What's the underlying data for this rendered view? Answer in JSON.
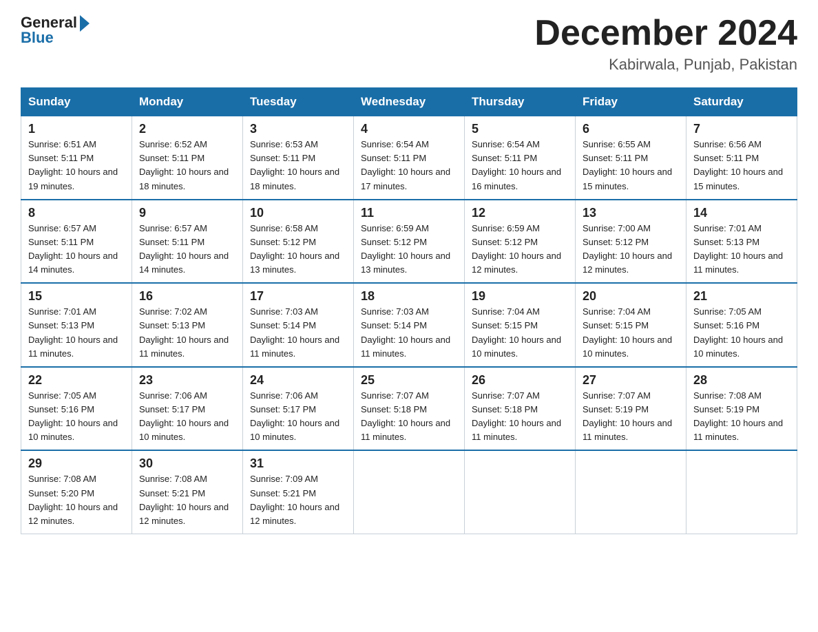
{
  "logo": {
    "general": "General",
    "blue": "Blue"
  },
  "title": {
    "month": "December 2024",
    "location": "Kabirwala, Punjab, Pakistan"
  },
  "weekdays": [
    "Sunday",
    "Monday",
    "Tuesday",
    "Wednesday",
    "Thursday",
    "Friday",
    "Saturday"
  ],
  "weeks": [
    [
      {
        "day": "1",
        "sunrise": "6:51 AM",
        "sunset": "5:11 PM",
        "daylight": "10 hours and 19 minutes."
      },
      {
        "day": "2",
        "sunrise": "6:52 AM",
        "sunset": "5:11 PM",
        "daylight": "10 hours and 18 minutes."
      },
      {
        "day": "3",
        "sunrise": "6:53 AM",
        "sunset": "5:11 PM",
        "daylight": "10 hours and 18 minutes."
      },
      {
        "day": "4",
        "sunrise": "6:54 AM",
        "sunset": "5:11 PM",
        "daylight": "10 hours and 17 minutes."
      },
      {
        "day": "5",
        "sunrise": "6:54 AM",
        "sunset": "5:11 PM",
        "daylight": "10 hours and 16 minutes."
      },
      {
        "day": "6",
        "sunrise": "6:55 AM",
        "sunset": "5:11 PM",
        "daylight": "10 hours and 15 minutes."
      },
      {
        "day": "7",
        "sunrise": "6:56 AM",
        "sunset": "5:11 PM",
        "daylight": "10 hours and 15 minutes."
      }
    ],
    [
      {
        "day": "8",
        "sunrise": "6:57 AM",
        "sunset": "5:11 PM",
        "daylight": "10 hours and 14 minutes."
      },
      {
        "day": "9",
        "sunrise": "6:57 AM",
        "sunset": "5:11 PM",
        "daylight": "10 hours and 14 minutes."
      },
      {
        "day": "10",
        "sunrise": "6:58 AM",
        "sunset": "5:12 PM",
        "daylight": "10 hours and 13 minutes."
      },
      {
        "day": "11",
        "sunrise": "6:59 AM",
        "sunset": "5:12 PM",
        "daylight": "10 hours and 13 minutes."
      },
      {
        "day": "12",
        "sunrise": "6:59 AM",
        "sunset": "5:12 PM",
        "daylight": "10 hours and 12 minutes."
      },
      {
        "day": "13",
        "sunrise": "7:00 AM",
        "sunset": "5:12 PM",
        "daylight": "10 hours and 12 minutes."
      },
      {
        "day": "14",
        "sunrise": "7:01 AM",
        "sunset": "5:13 PM",
        "daylight": "10 hours and 11 minutes."
      }
    ],
    [
      {
        "day": "15",
        "sunrise": "7:01 AM",
        "sunset": "5:13 PM",
        "daylight": "10 hours and 11 minutes."
      },
      {
        "day": "16",
        "sunrise": "7:02 AM",
        "sunset": "5:13 PM",
        "daylight": "10 hours and 11 minutes."
      },
      {
        "day": "17",
        "sunrise": "7:03 AM",
        "sunset": "5:14 PM",
        "daylight": "10 hours and 11 minutes."
      },
      {
        "day": "18",
        "sunrise": "7:03 AM",
        "sunset": "5:14 PM",
        "daylight": "10 hours and 11 minutes."
      },
      {
        "day": "19",
        "sunrise": "7:04 AM",
        "sunset": "5:15 PM",
        "daylight": "10 hours and 10 minutes."
      },
      {
        "day": "20",
        "sunrise": "7:04 AM",
        "sunset": "5:15 PM",
        "daylight": "10 hours and 10 minutes."
      },
      {
        "day": "21",
        "sunrise": "7:05 AM",
        "sunset": "5:16 PM",
        "daylight": "10 hours and 10 minutes."
      }
    ],
    [
      {
        "day": "22",
        "sunrise": "7:05 AM",
        "sunset": "5:16 PM",
        "daylight": "10 hours and 10 minutes."
      },
      {
        "day": "23",
        "sunrise": "7:06 AM",
        "sunset": "5:17 PM",
        "daylight": "10 hours and 10 minutes."
      },
      {
        "day": "24",
        "sunrise": "7:06 AM",
        "sunset": "5:17 PM",
        "daylight": "10 hours and 10 minutes."
      },
      {
        "day": "25",
        "sunrise": "7:07 AM",
        "sunset": "5:18 PM",
        "daylight": "10 hours and 11 minutes."
      },
      {
        "day": "26",
        "sunrise": "7:07 AM",
        "sunset": "5:18 PM",
        "daylight": "10 hours and 11 minutes."
      },
      {
        "day": "27",
        "sunrise": "7:07 AM",
        "sunset": "5:19 PM",
        "daylight": "10 hours and 11 minutes."
      },
      {
        "day": "28",
        "sunrise": "7:08 AM",
        "sunset": "5:19 PM",
        "daylight": "10 hours and 11 minutes."
      }
    ],
    [
      {
        "day": "29",
        "sunrise": "7:08 AM",
        "sunset": "5:20 PM",
        "daylight": "10 hours and 12 minutes."
      },
      {
        "day": "30",
        "sunrise": "7:08 AM",
        "sunset": "5:21 PM",
        "daylight": "10 hours and 12 minutes."
      },
      {
        "day": "31",
        "sunrise": "7:09 AM",
        "sunset": "5:21 PM",
        "daylight": "10 hours and 12 minutes."
      },
      null,
      null,
      null,
      null
    ]
  ],
  "labels": {
    "sunrise": "Sunrise: ",
    "sunset": "Sunset: ",
    "daylight": "Daylight: "
  }
}
